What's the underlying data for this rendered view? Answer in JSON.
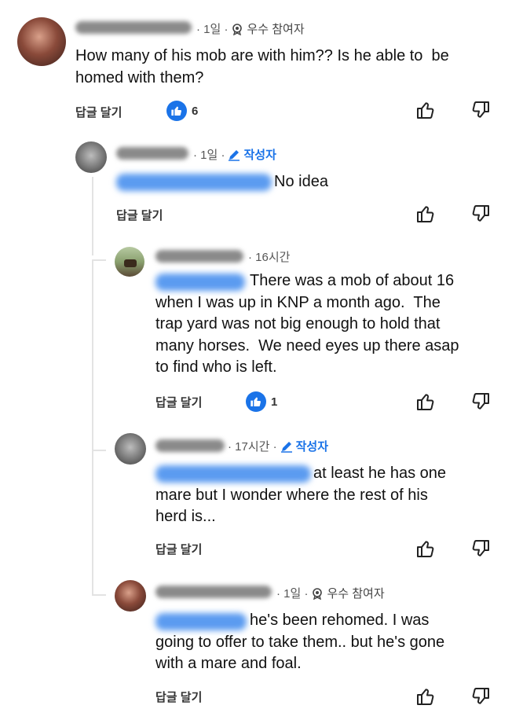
{
  "colors": {
    "accent": "#1a73e8",
    "mention_blur": "#3b82f6",
    "name_blur": "#8a8a8a"
  },
  "comments": [
    {
      "meta_time": "· 1일 ·",
      "badge_label": "우수 참여자",
      "badge_icon": "medal-icon",
      "text": "How many of his mob are with him?? Is he able to  be homed with them?",
      "reply_label": "답글 달기",
      "like_count": "6"
    },
    {
      "meta_time": "· 1일 ·",
      "badge_label": "작성자",
      "badge_icon": "pencil-icon",
      "text": "No idea",
      "reply_label": "답글 달기"
    },
    {
      "meta_time": "· 16시간",
      "text": "There was a mob of about 16\nwhen I was up in KNP a month ago.  The\ntrap yard was not big enough to hold that\nmany horses.  We need eyes up there asap\nto find who is left.",
      "reply_label": "답글 달기",
      "like_count": "1"
    },
    {
      "meta_time": "· 17시간 ·",
      "badge_label": "작성자",
      "badge_icon": "pencil-icon",
      "text": "at least he has one\nmare but I wonder where the rest of his\nherd is...",
      "reply_label": "답글 달기"
    },
    {
      "meta_time": "· 1일 ·",
      "badge_label": "우수 참여자",
      "badge_icon": "medal-icon",
      "text": "he's been rehomed. I was\ngoing to offer to take them.. but he's gone\nwith a mare and foal.",
      "reply_label": "답글 달기"
    }
  ]
}
